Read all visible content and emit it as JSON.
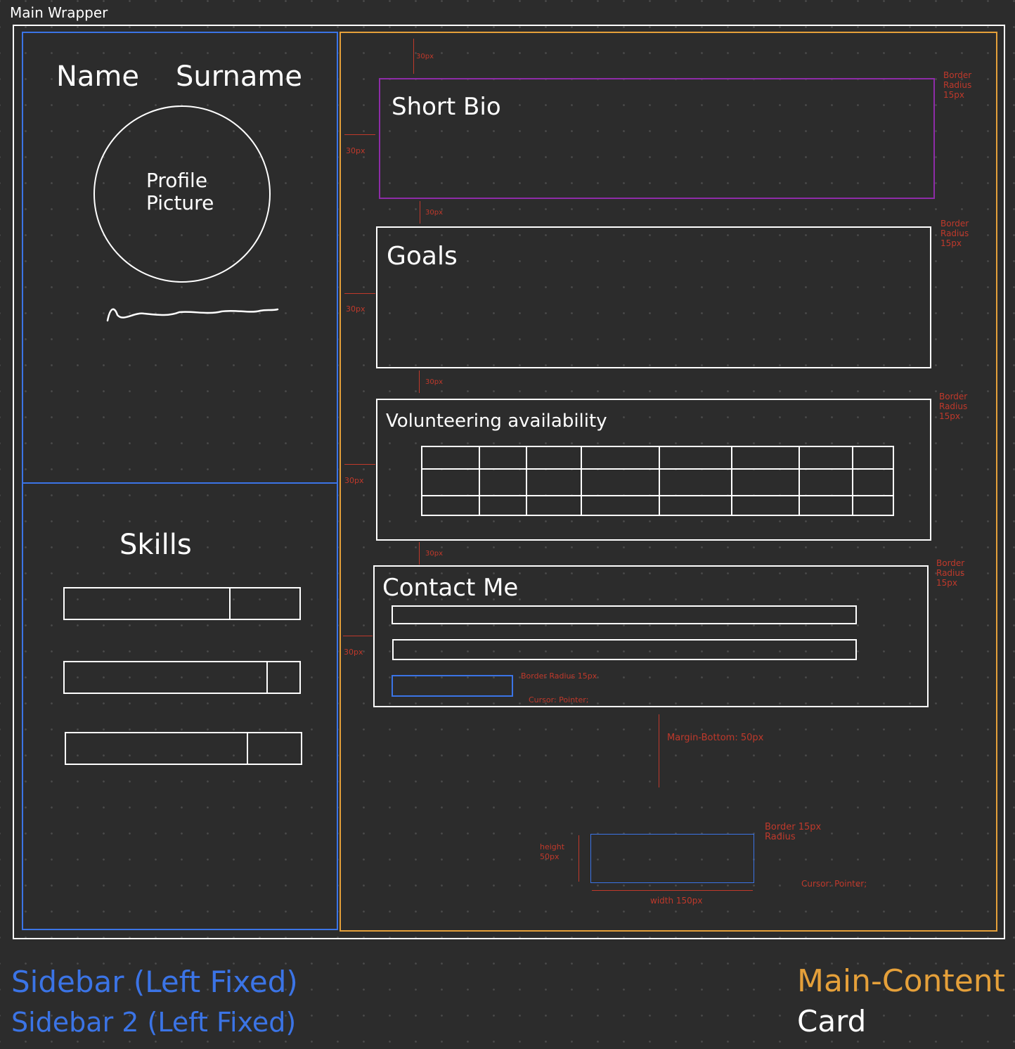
{
  "wrapper": {
    "label": "Main Wrapper"
  },
  "sidebar": {
    "name": "Name",
    "surname": "Surname",
    "profile_line1": "Profile",
    "profile_line2": "Picture",
    "skills_title": "Skills",
    "skills": [
      {
        "level": 0.7
      },
      {
        "level": 0.86
      },
      {
        "level": 0.77
      }
    ]
  },
  "main": {
    "bio_title": "Short Bio",
    "goals_title": "Goals",
    "volunteer_title": "Volunteering availability",
    "contact_title": "Contact Me"
  },
  "annotations": {
    "spacing": "30px",
    "radius_line1": "Border",
    "radius_line2": "Radius",
    "radius_line3": "15px",
    "btn_radius": "Border Radius 15px",
    "cursor": "Cursor: Pointer;",
    "margin_bottom": "Margin-Bottom: 50px",
    "height_line1": "height",
    "height_line2": "50px",
    "width_label": "width 150px",
    "bottom_radius": "Border 15px Radius"
  },
  "legend": {
    "sidebar": "Sidebar (Left Fixed)",
    "sidebar2": "Sidebar 2 (Left Fixed)",
    "main_content": "Main-Content",
    "card": "Card"
  },
  "colors": {
    "sidebar": "#3b74e6",
    "main_content": "#e5a03a",
    "bio": "#8e2ca8",
    "annotation": "#c0392b",
    "background": "#2c2c2c"
  }
}
